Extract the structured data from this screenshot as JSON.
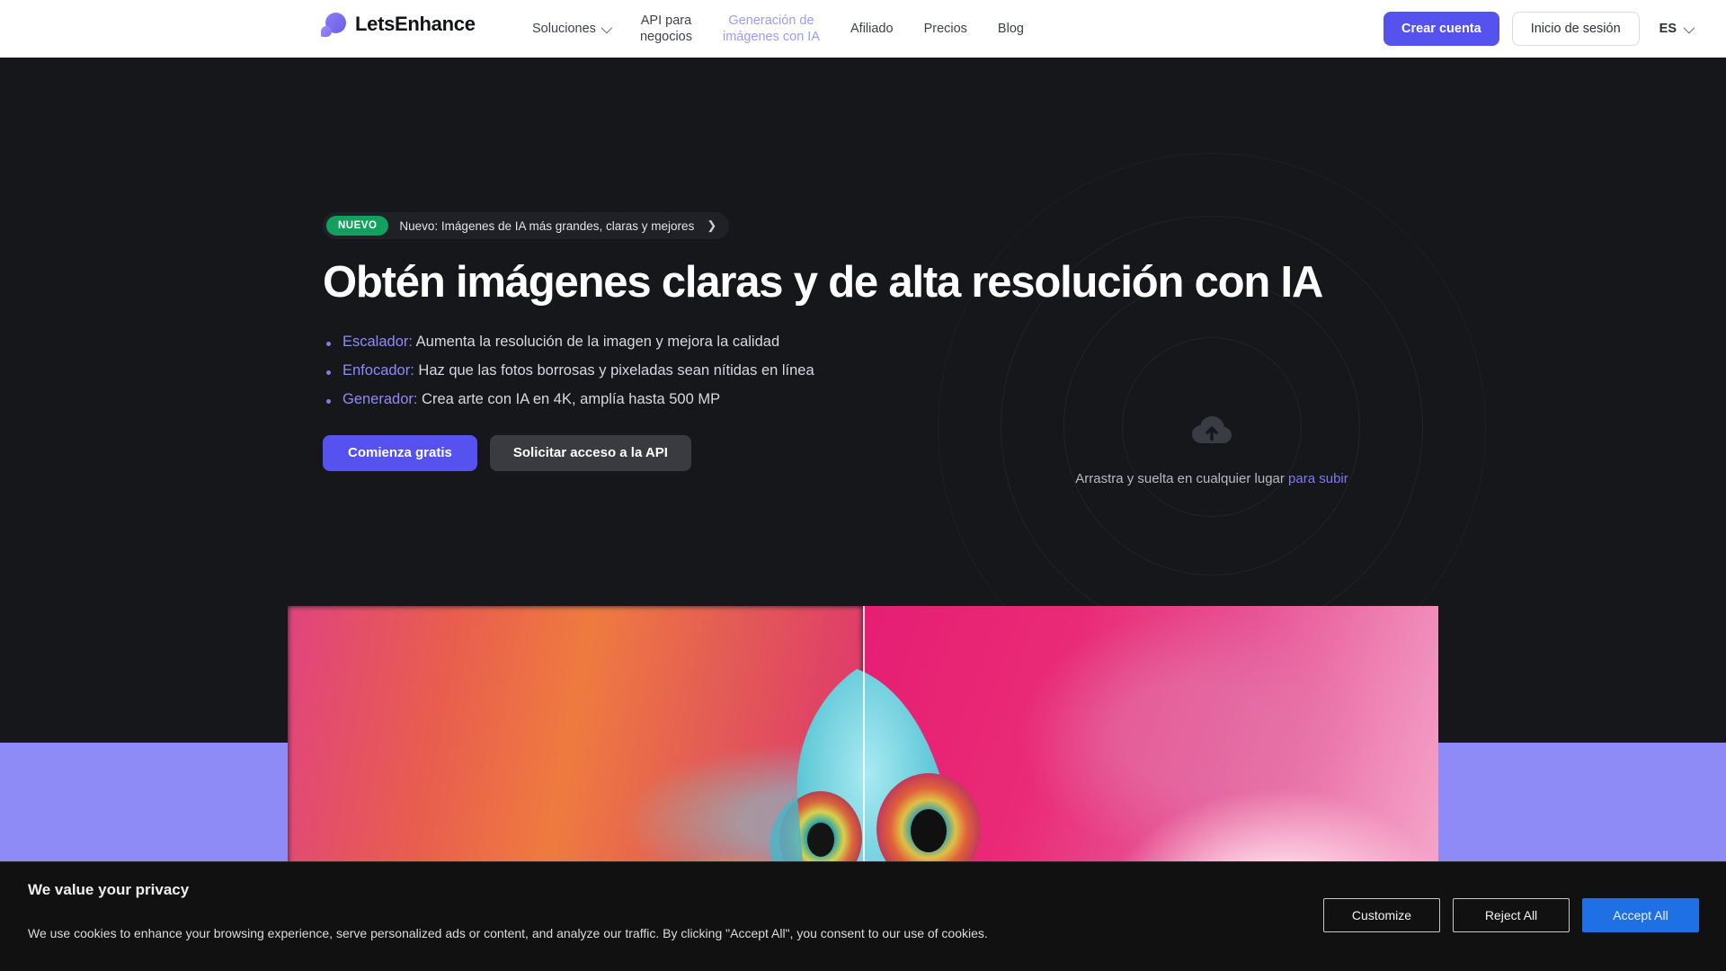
{
  "header": {
    "logo_text": "LetsEnhance",
    "nav": [
      {
        "label": "Soluciones",
        "has_chevron": true,
        "muted": false
      },
      {
        "label": "API para\nnegocios",
        "has_chevron": false,
        "muted": false
      },
      {
        "label": "Generación de\nimágenes con IA",
        "has_chevron": false,
        "muted": true
      },
      {
        "label": "Afiliado",
        "has_chevron": false,
        "muted": false
      },
      {
        "label": "Precios",
        "has_chevron": false,
        "muted": false
      },
      {
        "label": "Blog",
        "has_chevron": false,
        "muted": false
      }
    ],
    "signup_label": "Crear cuenta",
    "login_label": "Inicio de sesión",
    "language": "ES"
  },
  "hero": {
    "badge_tag": "NUEVO",
    "badge_text": "Nuevo: Imágenes de IA más grandes, claras y mejores",
    "badge_arrow": "❯",
    "headline": "Obtén imágenes claras y de alta resolución con IA",
    "features": [
      {
        "label": "Escalador:",
        "text": " Aumenta la resolución de la imagen y mejora la calidad"
      },
      {
        "label": "Enfocador:",
        "text": " Haz que las fotos borrosas y pixeladas sean nítidas en línea"
      },
      {
        "label": "Generador:",
        "text": " Crea arte con IA en 4K, amplía hasta 500 MP"
      }
    ],
    "primary_cta": "Comienza gratis",
    "secondary_cta": "Solicitar acceso a la API",
    "dropzone_text": "Arrastra y suelta en cualquier lugar ",
    "dropzone_link": "para subir",
    "dropzone_icon": "cloud-upload-icon"
  },
  "cookie_banner": {
    "title": "We value your privacy",
    "text": "We use cookies to enhance your browsing experience, serve personalized ads or content, and analyze our traffic. By clicking \"Accept All\", you consent to our use of cookies.",
    "customize_label": "Customize",
    "reject_label": "Reject All",
    "accept_label": "Accept All"
  },
  "colors": {
    "accent_purple": "#5552f0",
    "badge_green": "#12a05f",
    "band_purple": "#8e8bf7",
    "accept_blue": "#1f6fe5",
    "hero_bg": "#16171b",
    "header_bg": "#ffffff"
  }
}
